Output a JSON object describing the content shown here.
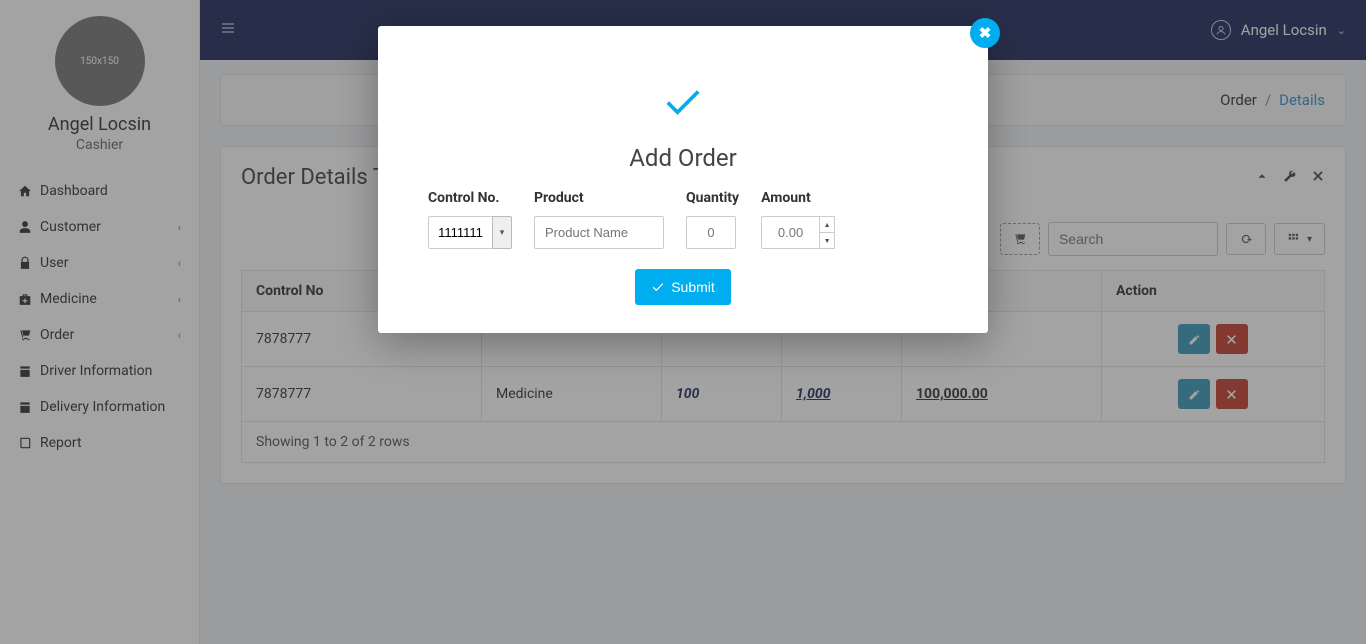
{
  "profile": {
    "name": "Angel Locsin",
    "role": "Cashier",
    "avatar_label": "150x150"
  },
  "topbar": {
    "username": "Angel Locsin"
  },
  "sidebar": {
    "items": [
      {
        "label": "Dashboard",
        "icon": "home",
        "expandable": false
      },
      {
        "label": "Customer",
        "icon": "user",
        "expandable": true
      },
      {
        "label": "User",
        "icon": "lock",
        "expandable": true
      },
      {
        "label": "Medicine",
        "icon": "medkit",
        "expandable": true
      },
      {
        "label": "Order",
        "icon": "cart",
        "expandable": true
      },
      {
        "label": "Driver Information",
        "icon": "calendar",
        "expandable": false
      },
      {
        "label": "Delivery Information",
        "icon": "calendar",
        "expandable": false
      },
      {
        "label": "Report",
        "icon": "book",
        "expandable": false
      }
    ]
  },
  "breadcrumb": {
    "parent": "Order",
    "current": "Details"
  },
  "panel": {
    "title": "Order Details Table"
  },
  "toolbar": {
    "search_placeholder": "Search"
  },
  "table": {
    "headers": {
      "control_no": "Control No",
      "action": "Action"
    },
    "rows": [
      {
        "control_no": "7878777",
        "product": "",
        "qty": "",
        "price": "",
        "amount": ""
      },
      {
        "control_no": "7878777",
        "product": "Medicine",
        "qty": "100",
        "price": "1,000",
        "amount": "100,000.00"
      }
    ],
    "footer": "Showing 1 to 2 of 2 rows"
  },
  "modal": {
    "title": "Add Order",
    "labels": {
      "control_no": "Control No.",
      "product": "Product",
      "quantity": "Quantity",
      "amount": "Amount"
    },
    "values": {
      "control_no": "1111111",
      "product_placeholder": "Product Name",
      "quantity_placeholder": "0",
      "amount_placeholder": "0.00"
    },
    "submit_label": "Submit"
  }
}
